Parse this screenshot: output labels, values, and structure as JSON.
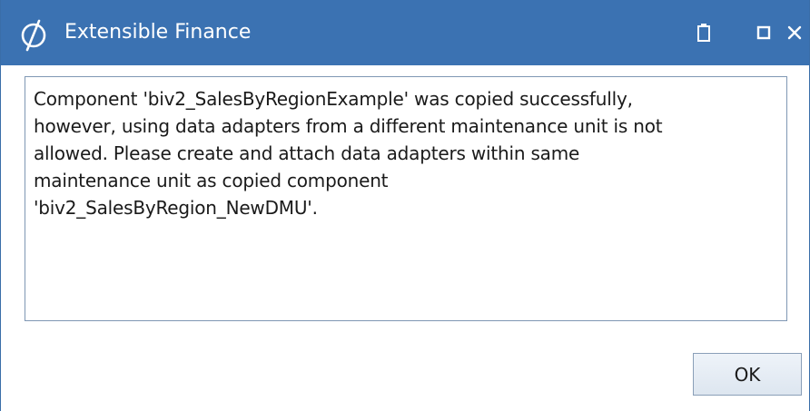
{
  "window": {
    "title": "Extensible Finance",
    "controls": {
      "restore_icon": "clipboard-icon",
      "maximize_icon": "square-icon",
      "close_icon": "close-icon"
    }
  },
  "message": {
    "lines": [
      "Component 'biv2_SalesByRegionExample' was copied successfully,",
      "however, using data adapters from a different maintenance unit is not",
      "allowed. Please create and attach data adapters within same",
      "maintenance unit as copied component",
      "'biv2_SalesByRegion_NewDMU'."
    ]
  },
  "buttons": {
    "ok_label": "OK"
  },
  "colors": {
    "titlebar": "#3b72b2",
    "border": "#7f97b4",
    "text": "#1a1a1a"
  }
}
